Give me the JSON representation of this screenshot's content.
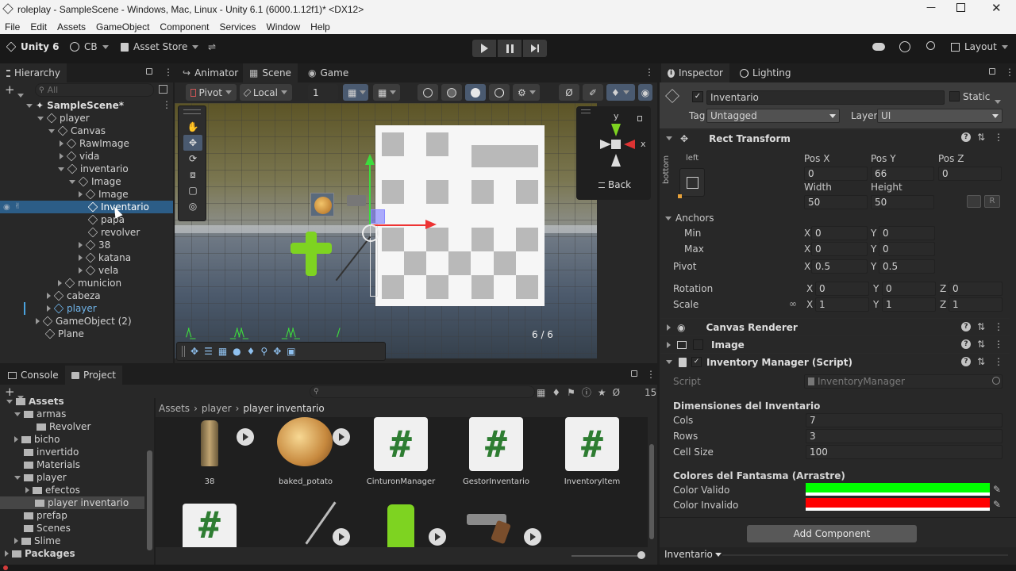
{
  "window": {
    "title": "roleplay - SampleScene - Windows, Mac, Linux - Unity 6.1 (6000.1.12f1)* <DX12>",
    "min_icon": "minimize-icon",
    "max_icon": "maximize-icon",
    "close_icon": "close-icon"
  },
  "menubar": [
    "File",
    "Edit",
    "Assets",
    "GameObject",
    "Component",
    "Services",
    "Window",
    "Help"
  ],
  "toolbar": {
    "unity": "Unity 6",
    "account": "CB",
    "asset_store": "Asset Store",
    "layout": "Layout"
  },
  "hierarchy": {
    "tab": "Hierarchy",
    "search_placeholder": "All",
    "items": [
      {
        "label": "SampleScene*"
      },
      {
        "label": "player"
      },
      {
        "label": "Canvas"
      },
      {
        "label": "RawImage"
      },
      {
        "label": "vida"
      },
      {
        "label": "inventario"
      },
      {
        "label": "Image"
      },
      {
        "label": "Image"
      },
      {
        "label": "Inventario"
      },
      {
        "label": "papa"
      },
      {
        "label": "revolver"
      },
      {
        "label": "38"
      },
      {
        "label": "katana"
      },
      {
        "label": "vela"
      },
      {
        "label": "municion"
      },
      {
        "label": "cabeza"
      },
      {
        "label": "player"
      },
      {
        "label": "GameObject (2)"
      },
      {
        "label": "Plane"
      }
    ]
  },
  "scene": {
    "tabs": [
      "Animator",
      "Scene",
      "Game"
    ],
    "pivot": "Pivot",
    "local": "Local",
    "grid_snap": "1",
    "gizmo_back": "Back",
    "gizmo_x": "x",
    "gizmo_y": "y",
    "counter": "6 / 6"
  },
  "inspector": {
    "tabs": [
      "Inspector",
      "Lighting"
    ],
    "object_name": "Inventario",
    "static": "Static",
    "tag_label": "Tag",
    "tag_value": "Untagged",
    "layer_label": "Layer",
    "layer_value": "UI",
    "rect": {
      "title": "Rect Transform",
      "anchor_h": "left",
      "anchor_v": "bottom",
      "posx_label": "Pos X",
      "posx": "0",
      "posy_label": "Pos Y",
      "posy": "66",
      "posz_label": "Pos Z",
      "posz": "0",
      "width_label": "Width",
      "width": "50",
      "height_label": "Height",
      "height": "50",
      "r_btn": "R",
      "anchors": "Anchors",
      "min": "Min",
      "min_x": "0",
      "min_y": "0",
      "max": "Max",
      "max_x": "0",
      "max_y": "0",
      "pivot": "Pivot",
      "pivot_x": "0.5",
      "pivot_y": "0.5",
      "rotation": "Rotation",
      "rot_x": "0",
      "rot_y": "0",
      "rot_z": "0",
      "scale": "Scale",
      "scale_x": "1",
      "scale_y": "1",
      "scale_z": "1",
      "x": "X",
      "y": "Y",
      "z": "Z"
    },
    "components": [
      "Canvas Renderer",
      "Image",
      "Inventory Manager (Script)"
    ],
    "script_label": "Script",
    "script_value": "InventoryManager",
    "section_dim": "Dimensiones del Inventario",
    "cols_label": "Cols",
    "cols": "7",
    "rows_label": "Rows",
    "rows": "3",
    "cell_label": "Cell Size",
    "cell": "100",
    "section_colors": "Colores del Fantasma (Arrastre)",
    "valid_label": "Color Valido",
    "valid_color": "#00ff00",
    "invalid_label": "Color Invalido",
    "invalid_color": "#ff0000",
    "add_component": "Add Component",
    "footer": "Inventario"
  },
  "project": {
    "tabs": [
      "Console",
      "Project"
    ],
    "badge": "15",
    "breadcrumb": [
      "Assets",
      "player",
      "player inventario"
    ],
    "tree": [
      {
        "label": "Assets"
      },
      {
        "label": "armas"
      },
      {
        "label": "Revolver"
      },
      {
        "label": "bicho"
      },
      {
        "label": "invertido"
      },
      {
        "label": "Materials"
      },
      {
        "label": "player"
      },
      {
        "label": "efectos"
      },
      {
        "label": "player inventario"
      },
      {
        "label": "prefap"
      },
      {
        "label": "Scenes"
      },
      {
        "label": "Slime"
      },
      {
        "label": "Packages"
      }
    ],
    "assets": [
      {
        "label": "38"
      },
      {
        "label": "baked_potato"
      },
      {
        "label": "CinturonManager"
      },
      {
        "label": "GestorInventario"
      },
      {
        "label": "InventoryItem"
      }
    ]
  }
}
